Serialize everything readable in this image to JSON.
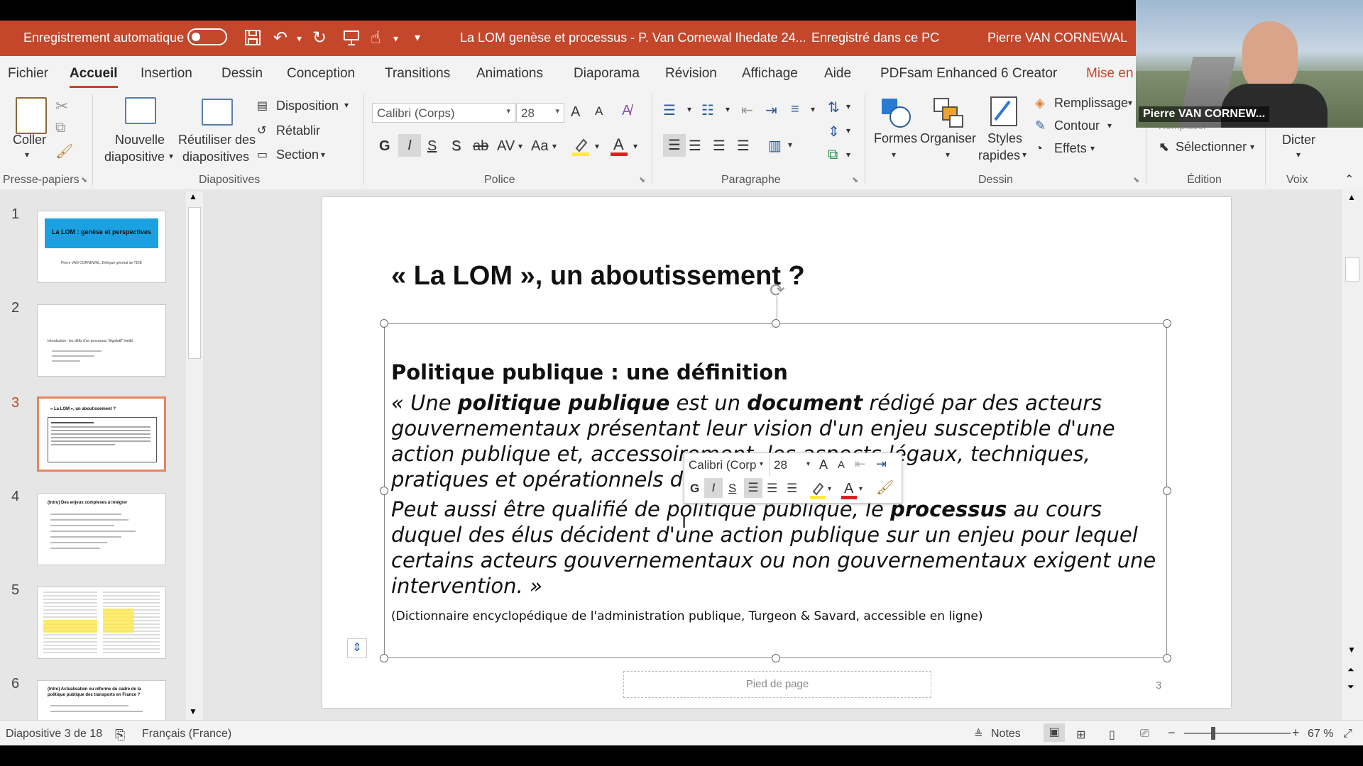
{
  "titlebar": {
    "autosave_label": "Enregistrement automatique",
    "doc_title": "La LOM genèse et processus - P. Van Cornewal Ihedate 24...",
    "save_status": "Enregistré dans ce PC",
    "user_name": "Pierre VAN CORNEWAL"
  },
  "menu": [
    "Fichier",
    "Accueil",
    "Insertion",
    "Dessin",
    "Conception",
    "Transitions",
    "Animations",
    "Diaporama",
    "Révision",
    "Affichage",
    "Aide",
    "PDFsam Enhanced 6 Creator",
    "Mise en"
  ],
  "ribbon": {
    "coller": "Coller",
    "nouvelle_1": "Nouvelle",
    "nouvelle_2": "diapositive",
    "reutiliser_1": "Réutiliser des",
    "reutiliser_2": "diapositives",
    "disposition": "Disposition",
    "retablir": "Rétablir",
    "section": "Section",
    "font_name": "Calibri (Corps)",
    "font_size": "28",
    "bold": "G",
    "italic": "I",
    "underline": "S",
    "strike": "S",
    "spacing": "AV",
    "case": "Aa",
    "grow": "A",
    "shrink": "A",
    "formes": "Formes",
    "organiser": "Organiser",
    "styles_1": "Styles",
    "styles_2": "rapides",
    "remplissage": "Remplissage",
    "contour": "Contour",
    "effets": "Effets",
    "remplacer": "Remplacer",
    "selectionner": "Sélectionner",
    "dicter": "Dicter",
    "groups": {
      "presse": "Presse-papiers",
      "diapos": "Diapositives",
      "police": "Police",
      "paragraphe": "Paragraphe",
      "dessin": "Dessin",
      "edition": "Édition",
      "voix": "Voix"
    }
  },
  "thumbnails": [
    {
      "num": "1",
      "title": "La LOM : genèse et perspectives",
      "subtitle": "Pierre VAN CORNEWAL, Délégué général de TDIE"
    },
    {
      "num": "2",
      "title": "Introduction : les défis d'un processus \"législatif\" inédit"
    },
    {
      "num": "3",
      "title": "« La LOM », un aboutissement ?"
    },
    {
      "num": "4",
      "title": "(Intro) Des enjeux complexes à intégrer"
    },
    {
      "num": "5"
    },
    {
      "num": "6",
      "title": "(Intro) Actualisation ou réforme du cadre de la politique publique des transports en France ?"
    }
  ],
  "slide": {
    "title": "« La LOM », un aboutissement ?",
    "heading": "Politique publique : une définition",
    "para1_a": "« Une ",
    "para1_b": "politique publique",
    "para1_c": " est un ",
    "para1_d": "document",
    "para1_e": " rédigé par des acteurs gouvernementaux présentant leur vision d'un enjeu susceptible d'une action publique et, accessoirement, les aspects légaux, techniques, pratiques et opérationnels de celle-ci.",
    "para2_a": "Peut aussi être qualifié de politique publique, le ",
    "para2_b": "processus",
    "para2_c": " au cours duquel des élus décident d'une action publique sur un enjeu pour lequel certains acteurs gouvernementaux ou non gouvernementaux exigent une intervention. »",
    "source": "(Dictionnaire encyclopédique de l'administration publique, Turgeon & Savard, accessible en ligne)",
    "footer_placeholder": "Pied de page",
    "page_number": "3"
  },
  "mini_toolbar": {
    "font_name": "Calibri (Corp",
    "font_size": "28"
  },
  "status": {
    "slide_count": "Diapositive 3 de 18",
    "language": "Français (France)",
    "notes": "Notes",
    "zoom": "67 %"
  },
  "webcam": {
    "name": "Pierre VAN CORNEW..."
  },
  "colors": {
    "accent": "#c4472c",
    "thumb_blue": "#1ba1e2"
  }
}
